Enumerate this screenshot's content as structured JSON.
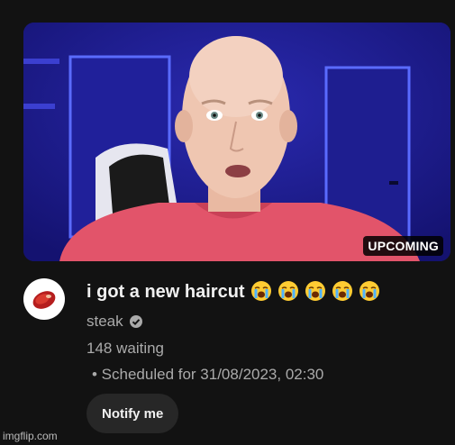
{
  "video": {
    "thumbnail_alt": "man with shaved head in pink sweater",
    "status_badge": "UPCOMING",
    "title": "i got a new haircut",
    "title_emojis": [
      "loudly-crying-face",
      "loudly-crying-face",
      "loudly-crying-face",
      "loudly-crying-face",
      "loudly-crying-face"
    ],
    "channel_name": "steak",
    "channel_verified": true,
    "waiting_count": "148 waiting",
    "scheduled_text": "• Scheduled for 31/08/2023, 02:30",
    "notify_label": "Notify me"
  },
  "watermark": "imgflip.com",
  "colors": {
    "background": "#121212",
    "primary_text": "#f1f1f1",
    "secondary_text": "#aaaaaa",
    "button_bg": "#272727",
    "led_blue": "#4a5dff",
    "sweater_pink": "#e2546a"
  }
}
